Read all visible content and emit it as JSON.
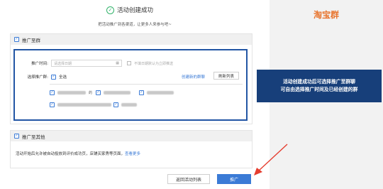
{
  "success": {
    "title": "活动创建成功",
    "subtitle": "把活动推广到各渠道，让更多人来参与吧~"
  },
  "promote_group": {
    "section_title": "推广至群",
    "time_label": "推广时间:",
    "date_placeholder": "请选择日期",
    "hint": "不填日期默认为立即推送",
    "groups_label": "选择推广群:",
    "all_label": "全选",
    "create_link": "创建新的群聊",
    "refresh_label": "刷新列表",
    "groups": [
      {
        "suffix": "的"
      },
      {
        "suffix": ""
      },
      {
        "suffix": ""
      },
      {
        "suffix": ""
      },
      {
        "suffix": ""
      }
    ]
  },
  "promote_other": {
    "section_title": "推广至其他",
    "text": "活动开始后允许被自动投放到评价成功页，店铺买家秀等页面，",
    "link": "查看更多"
  },
  "actions": {
    "back_label": "返回活动列表",
    "promote_label": "推广"
  },
  "side": {
    "brand": "淘宝群",
    "note_line1": "活动创建成功后可选择推广至群聊",
    "note_line2": "可自由选择推广时间及已经创建的群"
  },
  "colors": {
    "accent": "#3b7bd6",
    "success": "#33b36b",
    "brand": "#e8742d",
    "note_bg": "#173f7a",
    "highlight": "#2255a4",
    "arrow": "#e53d2f"
  }
}
